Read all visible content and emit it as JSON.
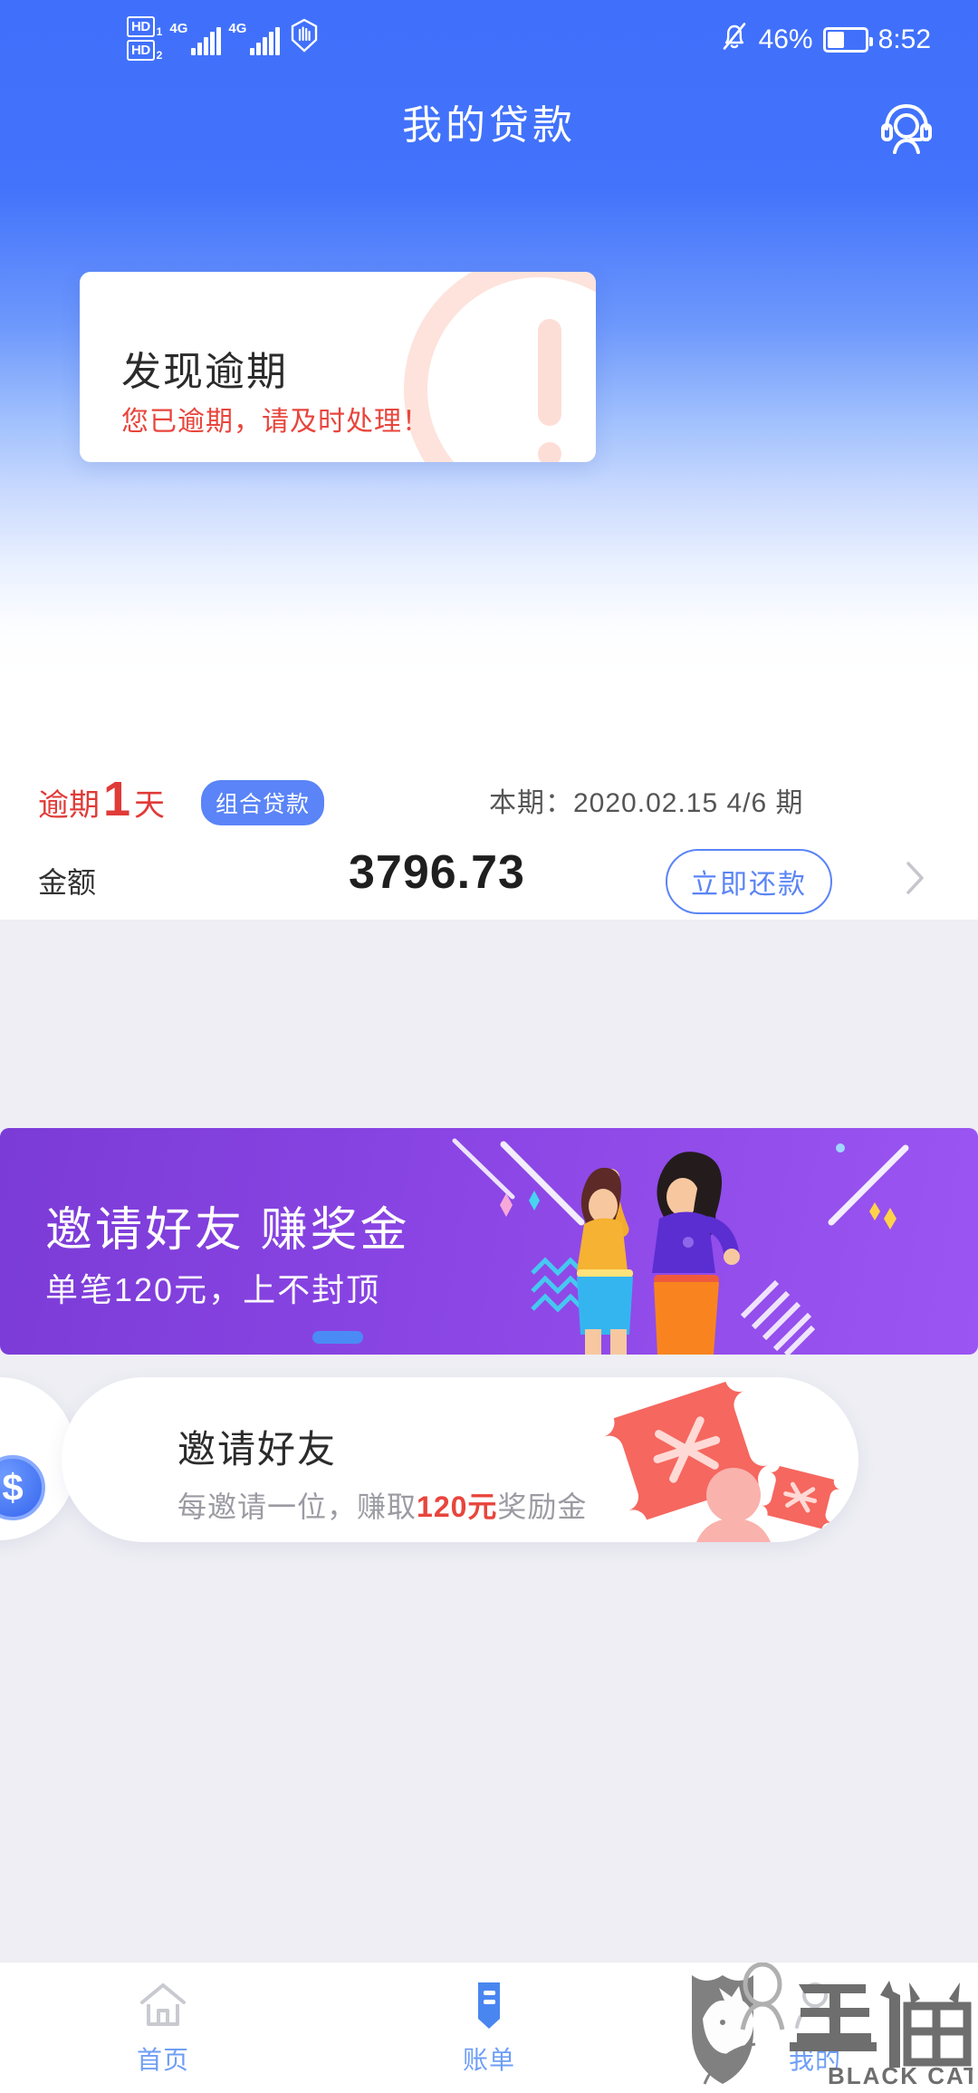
{
  "status_bar": {
    "hd1_label": "HD",
    "hd1_num": "1",
    "hd2_label": "HD",
    "hd2_num": "2",
    "net1": "4G",
    "net2": "4G",
    "mute_icon": "bell-muted-icon",
    "battery_percent": "46%",
    "battery_level": 46,
    "time": "8:52",
    "hand_icon": "hand-stop-icon",
    "signal_icon": "signal-bars-icon"
  },
  "app_bar": {
    "title": "我的贷款",
    "service_icon": "customer-service-icon"
  },
  "overdue_card": {
    "title": "发现逾期",
    "subtitle": "您已逾期，请及时处理！",
    "warning_icon": "exclamation-circle-icon"
  },
  "loan": {
    "overdue_prefix": "逾期",
    "overdue_days": "1",
    "overdue_suffix": "天",
    "badge": "组合贷款",
    "period": "本期：2020.02.15 4/6 期",
    "amount_label": "金额",
    "amount_value": "3796.73",
    "repay_button": "立即还款",
    "chevron_icon": "chevron-right-icon"
  },
  "promo_banner": {
    "title": "邀请好友 赚奖金",
    "subtitle": "单笔120元，上不封顶",
    "art": "two-women-celebrating-illustration"
  },
  "invite_card": {
    "title": "邀请好友",
    "sub_pre": "每邀请一位，赚取",
    "sub_highlight": "120元",
    "sub_post": "奖励金",
    "ticket_icon": "coupon-ticket-icon",
    "peek_coin_icon": "dollar-coin-icon"
  },
  "bottom_nav": {
    "items": [
      {
        "label": "首页",
        "icon": "home-icon",
        "active": false
      },
      {
        "label": "账单",
        "icon": "bill-icon",
        "active": true
      },
      {
        "label": "我的",
        "icon": "profile-icon",
        "active": false
      }
    ]
  },
  "watermark": {
    "cn": "黑猫",
    "en": "BLACK CAT",
    "icon": "black-cat-shield-logo"
  },
  "colors": {
    "brand_blue": "#4070fb",
    "accent_blue": "#5a84f7",
    "danger_red": "#e8453c",
    "promo_purple": "#8a45e4",
    "page_bg": "#eeeef4"
  }
}
